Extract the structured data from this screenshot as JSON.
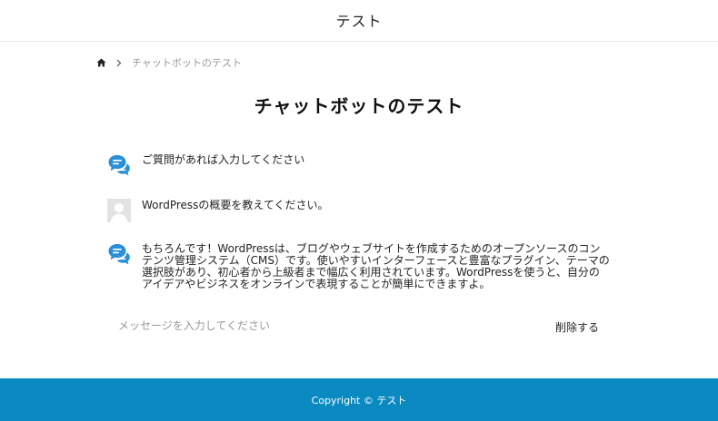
{
  "header": {
    "site_title": "テスト"
  },
  "breadcrumb": {
    "home_icon": "home-icon",
    "separator_icon": "chevron-right-icon",
    "current": "チャットボットのテスト"
  },
  "page": {
    "title": "チャットボットのテスト"
  },
  "chat": {
    "messages": [
      {
        "role": "bot",
        "icon": "chat-bubbles-icon",
        "text": "ご質問があれば入力してください"
      },
      {
        "role": "user",
        "icon": "user-avatar-icon",
        "text": "WordPressの概要を教えてください。"
      },
      {
        "role": "bot",
        "icon": "chat-bubbles-icon",
        "text": "もちろんです！WordPressは、ブログやウェブサイトを作成するためのオープンソースのコンテンツ管理システム（CMS）です。使いやすいインターフェースと豊富なプラグイン、テーマの選択肢があり、初心者から上級者まで幅広く利用されています。WordPressを使うと、自分のアイデアやビジネスをオンラインで表現することが簡単にできますよ。"
      }
    ],
    "input": {
      "placeholder": "メッセージを入力してください",
      "value": ""
    },
    "delete_label": "削除する"
  },
  "footer": {
    "copyright": "Copyright © テスト"
  },
  "colors": {
    "accent": "#0b8ac1",
    "bot_icon": "#2a8fd6",
    "avatar_bg": "#e3e3e3"
  }
}
